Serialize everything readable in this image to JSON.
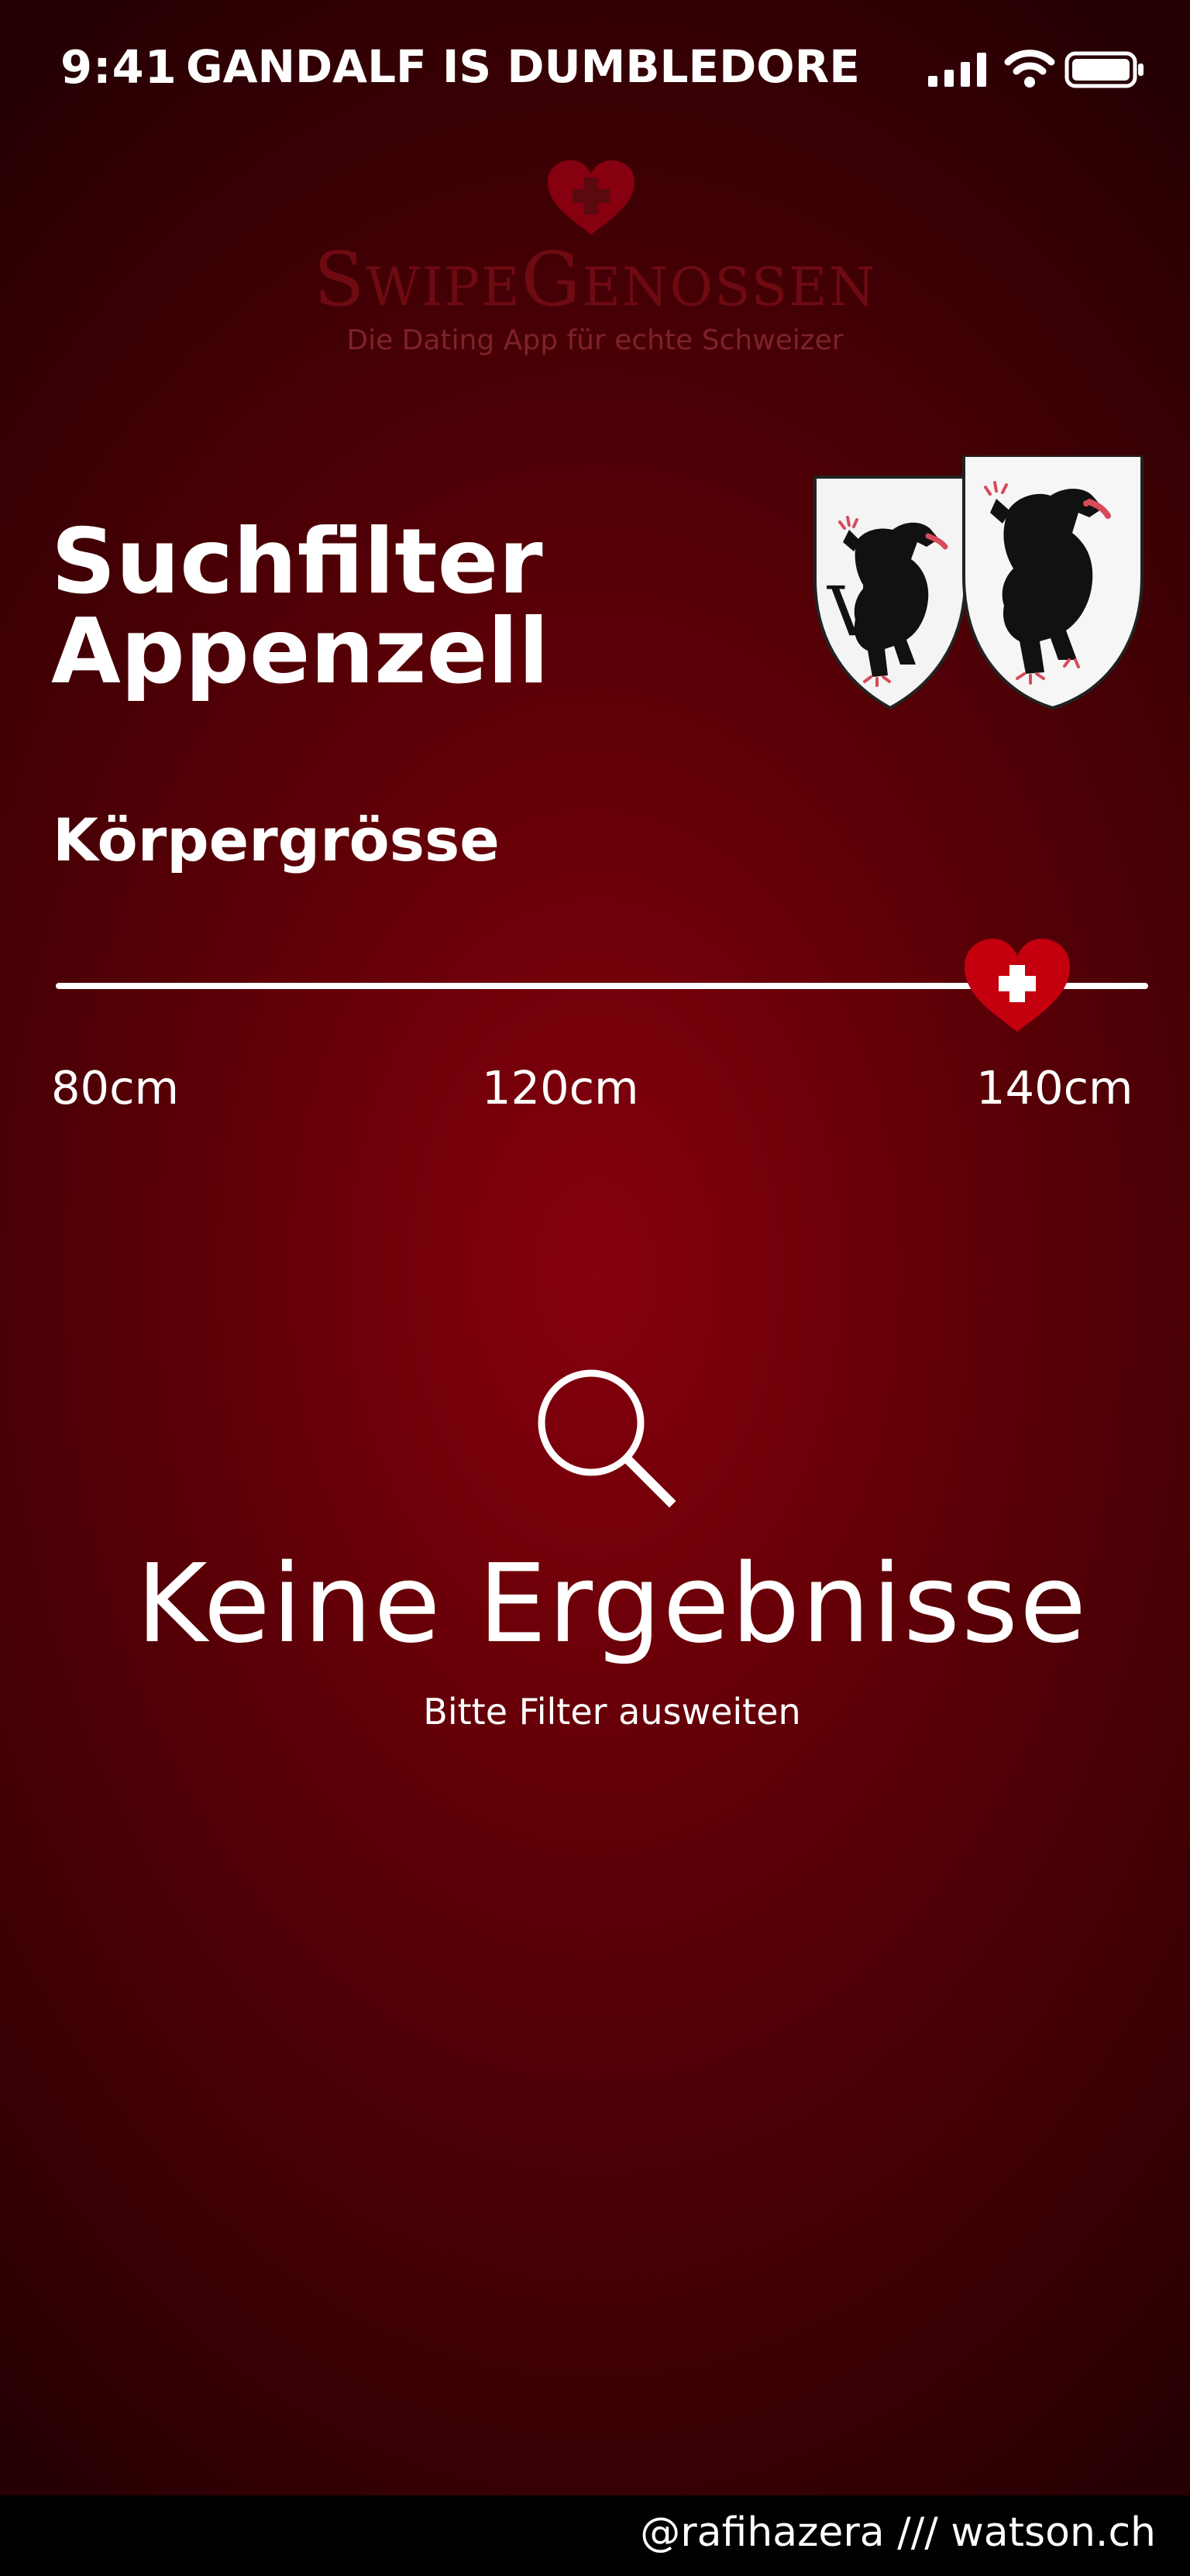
{
  "status_bar": {
    "time": "9:41",
    "carrier": "GANDALF IS DUMBLEDORE",
    "signal_icon": "cellular-signal-icon",
    "wifi_icon": "wifi-icon",
    "battery_icon": "battery-icon"
  },
  "brand": {
    "name_parts": [
      "S",
      "WIPE",
      "G",
      "ENOSSEN"
    ],
    "tagline": "Die Dating App für echte Schweizer",
    "heart_icon": "swiss-heart-icon"
  },
  "page": {
    "title_line1": "Suchfilter",
    "title_line2": "Appenzell",
    "crest_icon": "appenzell-coat-of-arms-icon"
  },
  "filter": {
    "label": "Körpergrösse",
    "min_label": "80cm",
    "mid_label": "120cm",
    "max_label": "140cm",
    "selected_fraction": 0.88,
    "thumb_icon": "swiss-heart-icon"
  },
  "empty_state": {
    "icon": "search-icon",
    "title": "Keine Ergebnisse",
    "subtitle": "Bitte Filter ausweiten"
  },
  "footer": {
    "credit": "@rafihazera /// watson.ch"
  },
  "colors": {
    "background_center": "#86000d",
    "background_edge": "#260003",
    "accent_red": "#c4000f",
    "logo_text": "#6e0a12",
    "text": "#ffffff"
  }
}
